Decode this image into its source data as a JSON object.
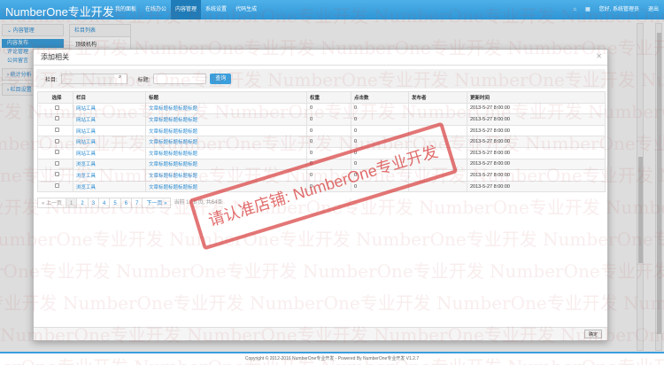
{
  "nav": {
    "brand": "NumberOne专业开发",
    "menu": [
      "我的面板",
      "在线办公",
      "内容管理",
      "系统设置",
      "代码生成"
    ],
    "active": 2,
    "greeting": "您好, 系统管理员",
    "logout": "退出"
  },
  "sidebar": {
    "header": "内容管理",
    "items": [
      "内容发布",
      "评论管理",
      "公共留言"
    ],
    "groups": [
      "统计分析",
      "栏目设置"
    ]
  },
  "column_panel": {
    "title": "栏目列表",
    "tree_root": "顶级机构"
  },
  "modal": {
    "title": "添加相关",
    "search": {
      "column_label": "栏目:",
      "column_value": "",
      "title_label": "标题:",
      "title_value": "",
      "query_button": "查询"
    },
    "table": {
      "headers": [
        "选择",
        "栏目",
        "标题",
        "权重",
        "点击数",
        "发布者",
        "更新时间"
      ],
      "rows": [
        [
          "网站工具",
          "文章标题标题标题标题",
          "0",
          "0",
          "",
          "2013-5-27 8:00:00"
        ],
        [
          "网站工具",
          "文章标题标题标题标题",
          "0",
          "0",
          "",
          "2013-5-27 8:00:00"
        ],
        [
          "网站工具",
          "文章标题标题标题标题",
          "0",
          "0",
          "",
          "2013-5-27 8:00:00"
        ],
        [
          "网站工具",
          "文章标题标题标题标题",
          "0",
          "0",
          "",
          "2013-5-27 8:00:00"
        ],
        [
          "网站工具",
          "文章标题标题标题标题",
          "0",
          "0",
          "",
          "2013-5-27 8:00:00"
        ],
        [
          "浏览工具",
          "文章标题标题标题标题",
          "0",
          "0",
          "",
          "2013-5-27 8:00:00"
        ],
        [
          "浏览工具",
          "文章标题标题标题标题",
          "0",
          "0",
          "",
          "2013-5-27 8:00:00"
        ],
        [
          "浏览工具",
          "文章标题标题标题标题",
          "0",
          "0",
          "",
          "2013-5-27 8:00:00"
        ]
      ]
    },
    "pagination": {
      "prev": "« 上一页",
      "pages": [
        "1",
        "2",
        "3",
        "4",
        "5",
        "6",
        "7"
      ],
      "current": "1",
      "next": "下一页 »",
      "info": "当前 1 / 8 页, 共64条"
    },
    "ok_button": "确定"
  },
  "stamp": "请认准店铺: NumberOne专业开发",
  "watermark": "NumberOne专业开发",
  "footer": "Copyright © 2012-2016 NumberOne专业开发 - Powered By NumberOne专业开发 V1.2.7"
}
